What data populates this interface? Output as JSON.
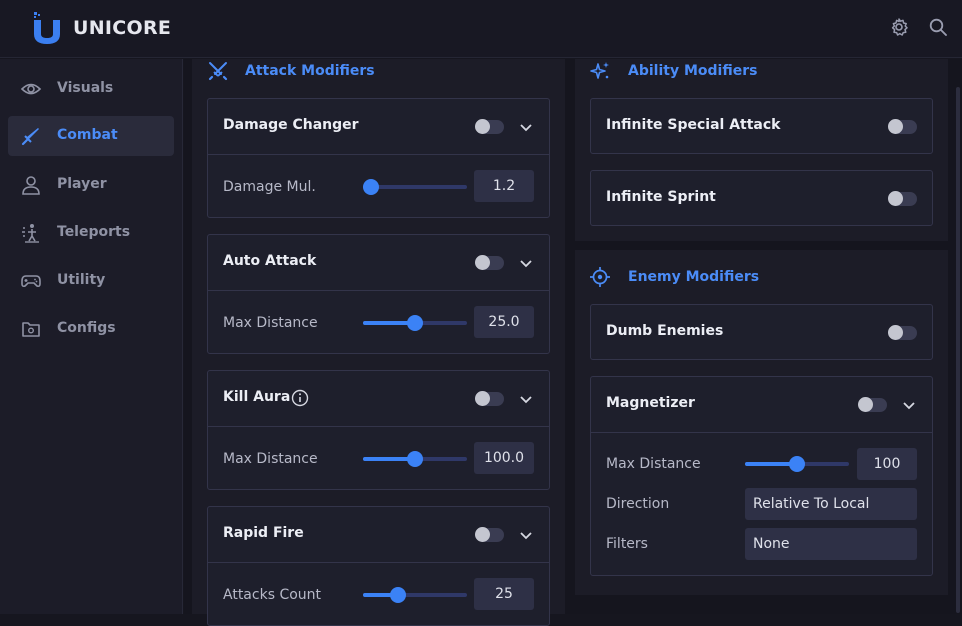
{
  "app": {
    "brand": "UNICORE"
  },
  "colors": {
    "accent": "#3b82f6",
    "accent_text": "#4b8cf7",
    "background": "#16161f",
    "panel": "#1c1c27",
    "card": "#1e1f2c"
  },
  "topbar": {
    "icons": [
      "gear-icon",
      "search-icon"
    ]
  },
  "sidebar": {
    "items": [
      {
        "label": "Visuals",
        "icon": "eye-icon",
        "active": false
      },
      {
        "label": "Combat",
        "icon": "sword-icon",
        "active": true
      },
      {
        "label": "Player",
        "icon": "user-icon",
        "active": false
      },
      {
        "label": "Teleports",
        "icon": "teleport-icon",
        "active": false
      },
      {
        "label": "Utility",
        "icon": "gamepad-icon",
        "active": false
      },
      {
        "label": "Configs",
        "icon": "folder-gear-icon",
        "active": false
      }
    ]
  },
  "left": {
    "title": "Attack Modifiers",
    "icon": "crossed-swords-icon",
    "cards": [
      {
        "title": "Damage Changer",
        "enabled": false,
        "setting": {
          "label": "Damage Mul.",
          "value": "1.2",
          "fill": 0.08
        }
      },
      {
        "title": "Auto Attack",
        "enabled": false,
        "setting": {
          "label": "Max Distance",
          "value": "25.0",
          "fill": 0.5
        }
      },
      {
        "title": "Kill Aura",
        "enabled": false,
        "info": true,
        "setting": {
          "label": "Max Distance",
          "value": "100.0",
          "fill": 0.5
        }
      },
      {
        "title": "Rapid Fire",
        "enabled": false,
        "setting": {
          "label": "Attacks Count",
          "value": "25",
          "fill": 0.34
        }
      }
    ]
  },
  "right": {
    "ability": {
      "title": "Ability Modifiers",
      "icon": "sparkles-icon",
      "cards": [
        {
          "title": "Infinite Special Attack",
          "enabled": false
        },
        {
          "title": "Infinite Sprint",
          "enabled": false
        }
      ]
    },
    "enemy": {
      "title": "Enemy Modifiers",
      "icon": "crosshair-icon",
      "cards": [
        {
          "title": "Dumb Enemies",
          "enabled": false
        },
        {
          "title": "Magnetizer",
          "enabled": false,
          "max_distance": {
            "label": "Max Distance",
            "value": "100",
            "fill": 0.5
          },
          "direction": {
            "label": "Direction",
            "value": "Relative To Local"
          },
          "filters": {
            "label": "Filters",
            "value": "None"
          }
        }
      ]
    }
  }
}
